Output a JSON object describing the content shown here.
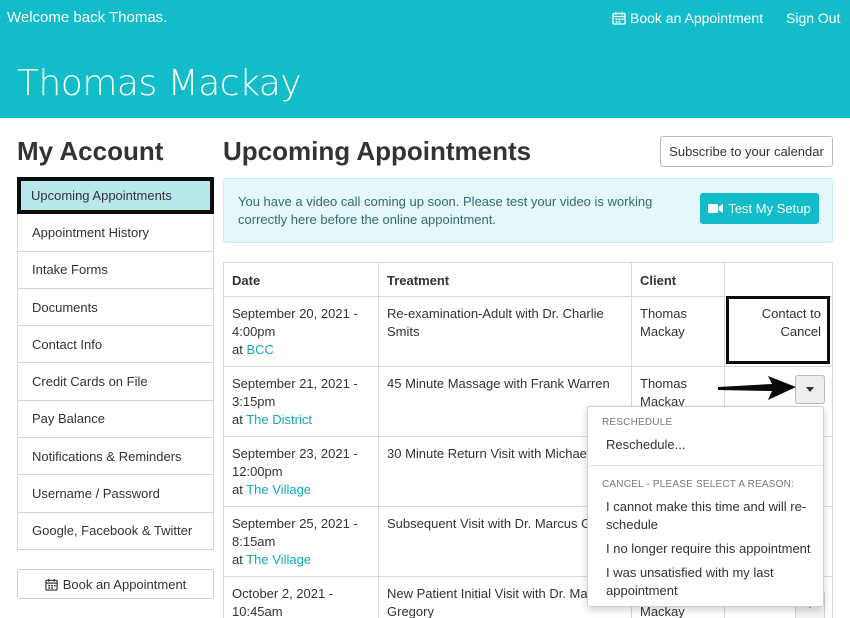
{
  "header": {
    "welcome": "Welcome back Thomas.",
    "book_label": "Book an Appointment",
    "signout_label": "Sign Out",
    "user_name": "Thomas Mackay"
  },
  "sidebar": {
    "title": "My Account",
    "items": [
      {
        "label": "Upcoming Appointments"
      },
      {
        "label": "Appointment History"
      },
      {
        "label": "Intake Forms"
      },
      {
        "label": "Documents"
      },
      {
        "label": "Contact Info"
      },
      {
        "label": "Credit Cards on File"
      },
      {
        "label": "Pay Balance"
      },
      {
        "label": "Notifications & Reminders"
      },
      {
        "label": "Username / Password"
      },
      {
        "label": "Google, Facebook & Twitter"
      }
    ],
    "book_label": "Book an Appointment"
  },
  "main": {
    "title": "Upcoming Appointments",
    "subscribe_label": "Subscribe to your calendar",
    "alert_text": "You have a video call coming up soon. Please test your video is working correctly here before the online appointment.",
    "test_label": "Test My Setup"
  },
  "table": {
    "headers": [
      "Date",
      "Treatment",
      "Client",
      ""
    ],
    "rows": [
      {
        "date": "September 20, 2021 - 4:00pm",
        "at": "at",
        "location": "BCC",
        "treatment": "Re-examination-Adult with Dr. Charlie Smits",
        "client": "Thomas Mackay",
        "action": "Contact to Cancel"
      },
      {
        "date": "September 21, 2021 - 3:15pm",
        "at": "at",
        "location": "The District",
        "treatment": "45 Minute Massage with Frank Warren",
        "client": "Thomas Mackay"
      },
      {
        "date": "September 23, 2021 - 12:00pm",
        "at": "at",
        "location": "The Village",
        "treatment": "30 Minute Return Visit with Michael C",
        "client": ""
      },
      {
        "date": "September 25, 2021 - 8:15am",
        "at": "at",
        "location": "The Village",
        "treatment": "Subsequent Visit with Dr. Marcus Gre",
        "client": ""
      },
      {
        "date": "October 2, 2021 - 10:45am",
        "at": "",
        "location": "",
        "treatment": "New Patient Initial Visit with Dr. Marc Gregory",
        "client": "Mackay"
      }
    ]
  },
  "dropdown": {
    "reschedule_header": "RESCHEDULE",
    "reschedule_item": "Reschedule...",
    "cancel_header": "CANCEL - PLEASE SELECT A REASON:",
    "cancel_items": [
      "I cannot make this time and will re-schedule",
      "I no longer require this appointment",
      "I was unsatisfied with my last appointment"
    ]
  },
  "colors": {
    "brand": "#12bdc9",
    "link": "#12aab5",
    "alert_bg": "#e5f7f9",
    "active_bg": "#b8e8ec"
  },
  "icons": {
    "book": "calendar-icon",
    "test": "video-camera-icon",
    "dropdown": "caret-down-icon",
    "annotation": "arrow-icon"
  }
}
